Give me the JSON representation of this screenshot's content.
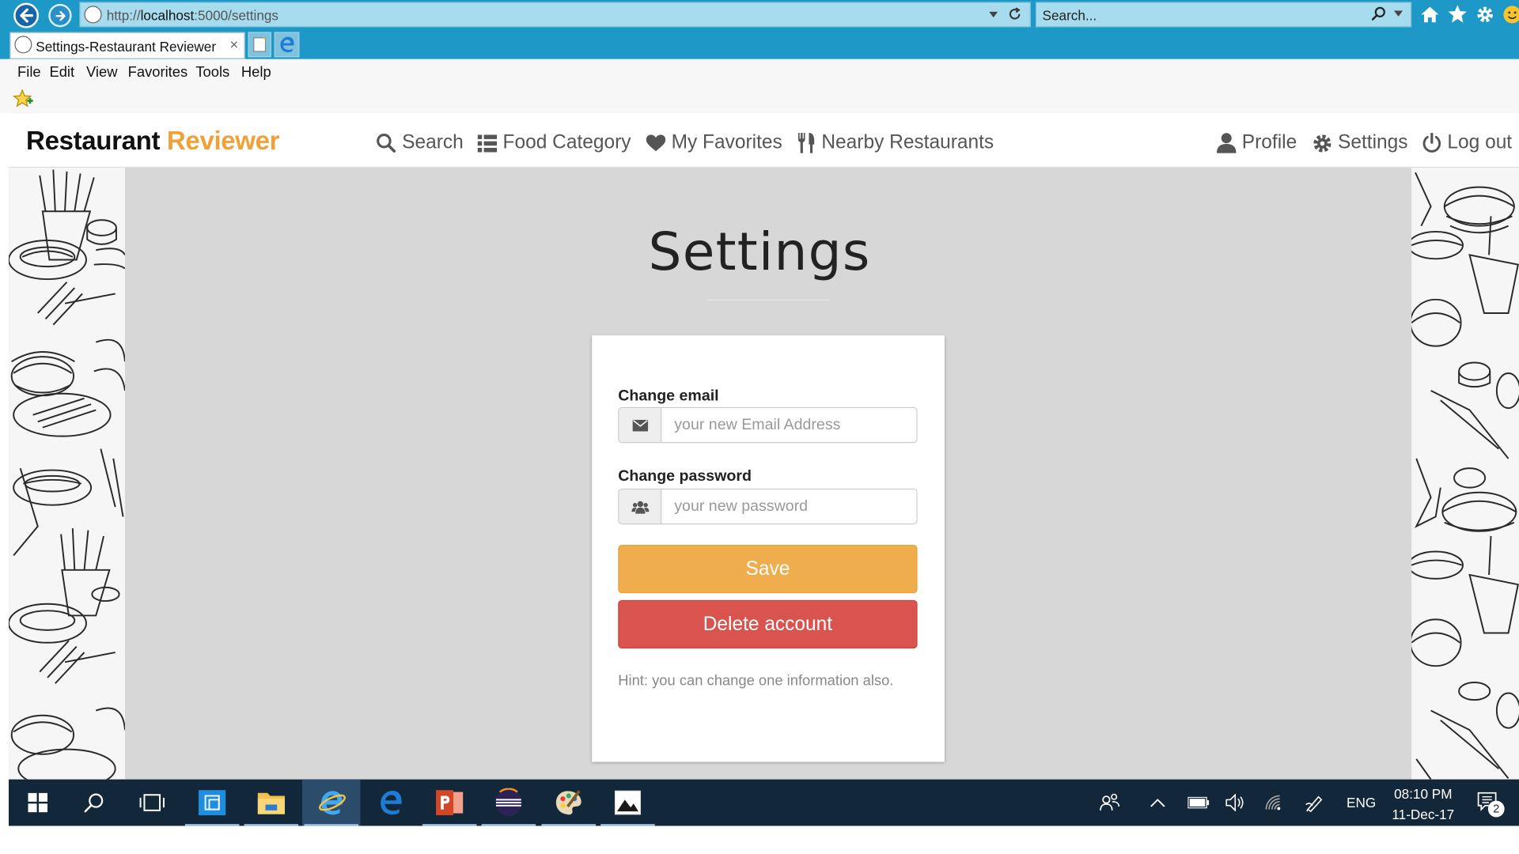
{
  "browser": {
    "url_prefix": "http://",
    "url_host": "localhost",
    "url_rest": ":5000/settings",
    "search_placeholder": "Search...",
    "tab_title": "Settings-Restaurant Reviewer",
    "tab_close": "×",
    "menu": [
      "File",
      "Edit",
      "View",
      "Favorites",
      "Tools",
      "Help"
    ]
  },
  "app": {
    "brand_main": "Restaurant",
    "brand_accent": "Reviewer",
    "nav_left": [
      {
        "label": "Search",
        "icon": "search-icon"
      },
      {
        "label": "Food Category",
        "icon": "list-icon"
      },
      {
        "label": "My Favorites",
        "icon": "heart-icon"
      },
      {
        "label": "Nearby Restaurants",
        "icon": "cutlery-icon"
      }
    ],
    "nav_right": [
      {
        "label": "Profile",
        "icon": "user-icon"
      },
      {
        "label": "Settings",
        "icon": "gear-icon"
      },
      {
        "label": "Log out",
        "icon": "power-icon"
      }
    ]
  },
  "page": {
    "title": "Settings"
  },
  "form": {
    "email_label": "Change email",
    "email_placeholder": "your new Email Address",
    "email_value": "",
    "password_label": "Change password",
    "password_placeholder": "your new password",
    "password_value": "",
    "save_label": "Save",
    "delete_label": "Delete account",
    "hint": "Hint: you can change one information also."
  },
  "taskbar": {
    "language": "ENG",
    "time": "08:10 PM",
    "date": "11-Dec-17",
    "notification_count": "2"
  },
  "colors": {
    "browser_blue": "#1d98c7",
    "brand_accent": "#f0a23a",
    "save_button": "#f0ad4e",
    "delete_button": "#d9534f",
    "page_background": "#d7d7d7",
    "taskbar": "#13273a"
  }
}
